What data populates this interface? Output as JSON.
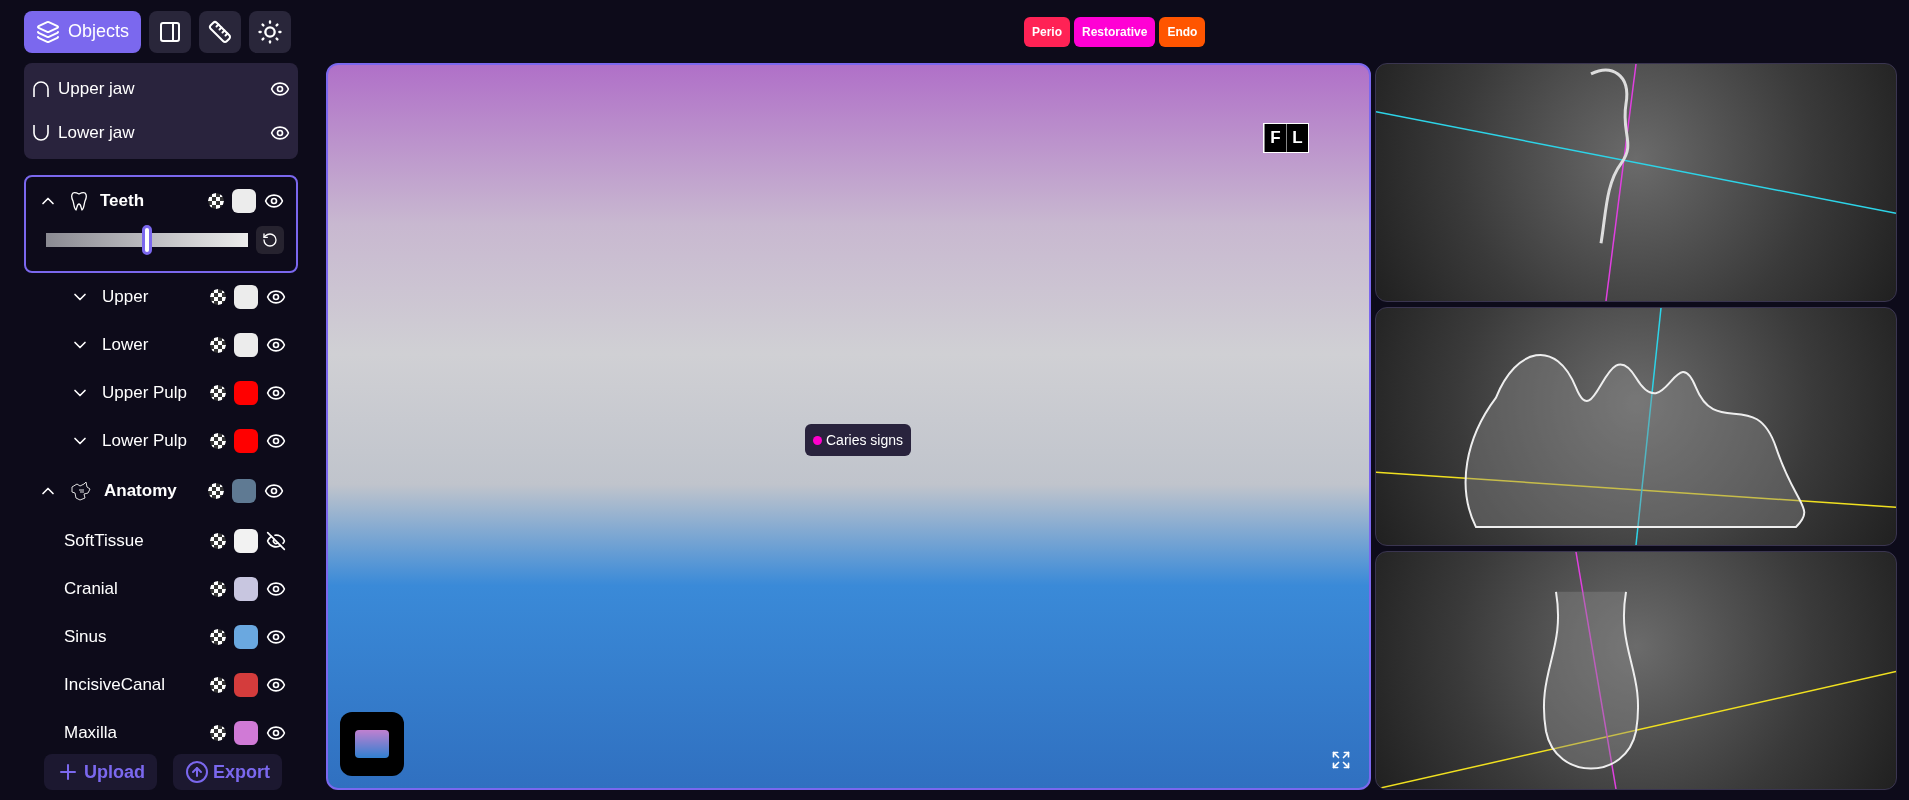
{
  "toolbar": [
    {
      "kind": "label",
      "label": "Objects",
      "selected": true
    },
    {
      "kind": "panel",
      "selected": false
    },
    {
      "kind": "ruler",
      "selected": false
    },
    {
      "kind": "brightness",
      "selected": false
    }
  ],
  "tags": [
    {
      "label": "Perio",
      "color": "#ff2255"
    },
    {
      "label": "Restorative",
      "color": "#ff00d4"
    },
    {
      "label": "Endo",
      "color": "#ff5500"
    }
  ],
  "jaws": [
    {
      "kind": "upper",
      "label": "Upper jaw",
      "visible": true
    },
    {
      "kind": "lower",
      "label": "Lower jaw",
      "visible": true
    }
  ],
  "groups": [
    {
      "kind": "teeth",
      "label": "Teeth",
      "expanded": true,
      "selected": true,
      "color": "#ececec",
      "visible": true,
      "level": 0.5,
      "children": [
        {
          "label": "Upper",
          "expanded": false,
          "color": "#ececec",
          "visible": true
        },
        {
          "label": "Lower",
          "expanded": false,
          "color": "#ececec",
          "visible": true
        },
        {
          "label": "Upper Pulp",
          "expanded": false,
          "color": "#ff0000",
          "visible": true
        },
        {
          "label": "Lower Pulp",
          "expanded": false,
          "color": "#ff0000",
          "visible": true
        }
      ]
    },
    {
      "kind": "anatomy",
      "label": "Anatomy",
      "expanded": true,
      "selected": false,
      "color": "#5f7a93",
      "visible": true,
      "children": [
        {
          "label": "SoftTissue",
          "color": "#f2f2f2",
          "visible": false
        },
        {
          "label": "Cranial",
          "color": "#c8c6e0",
          "visible": true
        },
        {
          "label": "Sinus",
          "color": "#6aa8e0",
          "visible": true
        },
        {
          "label": "IncisiveCanal",
          "color": "#d43c3c",
          "visible": true
        },
        {
          "label": "Maxilla",
          "color": "#d07ad6",
          "visible": true
        }
      ]
    }
  ],
  "footer_buttons": [
    {
      "kind": "upload",
      "label": "Upload"
    },
    {
      "kind": "export",
      "label": "Export"
    }
  ],
  "viewer": {
    "orientation": [
      "F",
      "L"
    ],
    "marker": {
      "label": "Caries signs",
      "color": "#ff00cc"
    }
  }
}
